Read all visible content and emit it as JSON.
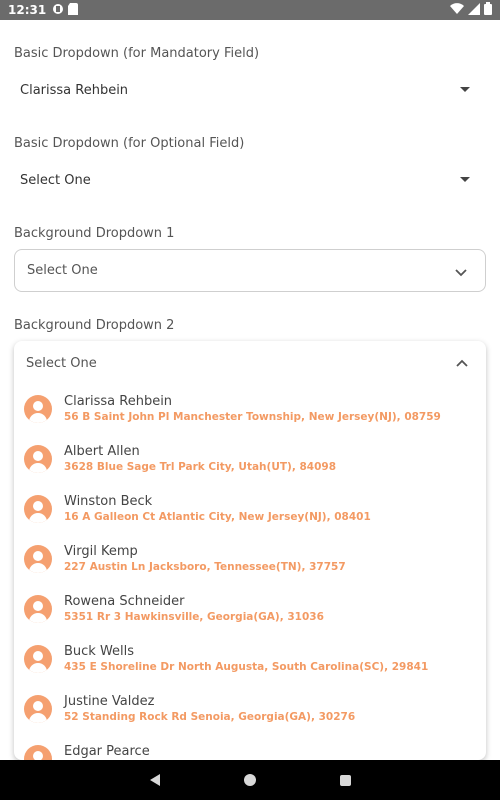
{
  "status_bar": {
    "time": "12:31"
  },
  "basic_mandatory": {
    "label": "Basic Dropdown (for Mandatory Field)",
    "value": "Clarissa Rehbein"
  },
  "basic_optional": {
    "label": "Basic Dropdown (for Optional Field)",
    "value": "Select One"
  },
  "background_1": {
    "label": "Background Dropdown 1",
    "value": "Select One"
  },
  "background_2": {
    "label": "Background Dropdown 2",
    "value": "Select One",
    "options": [
      {
        "name": "Clarissa Rehbein",
        "address": "56 B Saint John Pl Manchester Township, New Jersey(NJ), 08759"
      },
      {
        "name": "Albert Allen",
        "address": "3628 Blue Sage Trl Park City, Utah(UT), 84098"
      },
      {
        "name": "Winston Beck",
        "address": "16 A Galleon Ct Atlantic City, New Jersey(NJ), 08401"
      },
      {
        "name": "Virgil Kemp",
        "address": "227 Austin Ln Jacksboro, Tennessee(TN), 37757"
      },
      {
        "name": "Rowena Schneider",
        "address": "5351 Rr 3 Hawkinsville, Georgia(GA), 31036"
      },
      {
        "name": "Buck Wells",
        "address": "435 E Shoreline Dr North Augusta, South Carolina(SC), 29841"
      },
      {
        "name": "Justine Valdez",
        "address": "52 Standing Rock Rd Senoia, Georgia(GA), 30276"
      },
      {
        "name": "Edgar Pearce",
        "address": ""
      }
    ]
  },
  "colors": {
    "accent": "#f5a070",
    "address_text": "#f39a63"
  }
}
